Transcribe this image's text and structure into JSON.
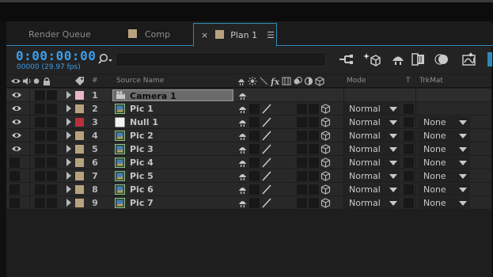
{
  "tabs": [
    {
      "label": "Render Queue"
    },
    {
      "label": "Comp"
    },
    {
      "label": "Plan 1"
    }
  ],
  "comp": {
    "timecode": "0:00:00:00",
    "fps": "00000 (29.97 fps)"
  },
  "columns": {
    "number": "#",
    "source_name": "Source Name",
    "mode": "Mode",
    "t": "T",
    "trkmat": "TrkMat"
  },
  "colors": {
    "accent": "#3d9de8",
    "label_pink": "#e8b8c8",
    "label_tan": "#b8a27e",
    "label_red": "#b8303a"
  },
  "layers": [
    {
      "num": "1",
      "name": "Camera 1",
      "label_color": "#e8b8c8",
      "type": "camera",
      "mode": "",
      "trkmat": ""
    },
    {
      "num": "2",
      "name": "Pic 1",
      "label_color": "#b8a27e",
      "type": "image",
      "mode": "Normal",
      "trkmat": ""
    },
    {
      "num": "3",
      "name": "Null 1",
      "label_color": "#b8303a",
      "type": "null",
      "mode": "Normal",
      "trkmat": "None"
    },
    {
      "num": "4",
      "name": "Pic 2",
      "label_color": "#b8a27e",
      "type": "image",
      "mode": "Normal",
      "trkmat": "None"
    },
    {
      "num": "5",
      "name": "Pic 3",
      "label_color": "#b8a27e",
      "type": "image",
      "mode": "Normal",
      "trkmat": "None"
    },
    {
      "num": "6",
      "name": "Pic 4",
      "label_color": "#b8a27e",
      "type": "image",
      "mode": "Normal",
      "trkmat": "None"
    },
    {
      "num": "7",
      "name": "Pic 5",
      "label_color": "#b8a27e",
      "type": "image",
      "mode": "Normal",
      "trkmat": "None"
    },
    {
      "num": "8",
      "name": "Pic 6",
      "label_color": "#b8a27e",
      "type": "image",
      "mode": "Normal",
      "trkmat": "None"
    },
    {
      "num": "9",
      "name": "Pic 7",
      "label_color": "#b8a27e",
      "type": "image",
      "mode": "Normal",
      "trkmat": "None"
    }
  ]
}
